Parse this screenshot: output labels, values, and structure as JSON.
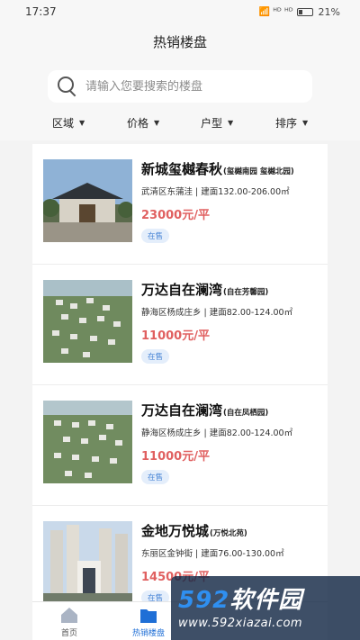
{
  "status_bar": {
    "time": "17:37",
    "signal_icons": "📶 ᴴᴰ ᴴᴰ",
    "battery": "21%"
  },
  "header": {
    "title": "热销楼盘"
  },
  "search": {
    "placeholder": "请输入您要搜索的楼盘"
  },
  "filters": [
    {
      "label": "区域"
    },
    {
      "label": "价格"
    },
    {
      "label": "户型"
    },
    {
      "label": "排序"
    }
  ],
  "listings": [
    {
      "name": "新城玺樾春秋",
      "sub": "(玺樾南园 玺樾北园)",
      "location": "武清区东蒲洼 | 建面132.00-206.00㎡",
      "price": "23000元/平",
      "status": "在售"
    },
    {
      "name": "万达自在澜湾",
      "sub": "(自在芳馨园)",
      "location": "静海区杨成庄乡 | 建面82.00-124.00㎡",
      "price": "11000元/平",
      "status": "在售"
    },
    {
      "name": "万达自在澜湾",
      "sub": "(自在凤栖园)",
      "location": "静海区杨成庄乡 | 建面82.00-124.00㎡",
      "price": "11000元/平",
      "status": "在售"
    },
    {
      "name": "金地万悦城",
      "sub": "(万悦北苑)",
      "location": "东丽区金钟街 | 建面76.00-130.00㎡",
      "price": "14500元/平",
      "status": "在售"
    }
  ],
  "tabbar": [
    {
      "label": "首页"
    },
    {
      "label": "热销楼盘"
    }
  ],
  "watermark": {
    "logo_num": "592",
    "logo_text": "软件园",
    "url": "www.592xiazai.com"
  },
  "colors": {
    "price": "#e06060",
    "accent": "#1f6fd6",
    "badge_bg": "#e4eefb"
  }
}
